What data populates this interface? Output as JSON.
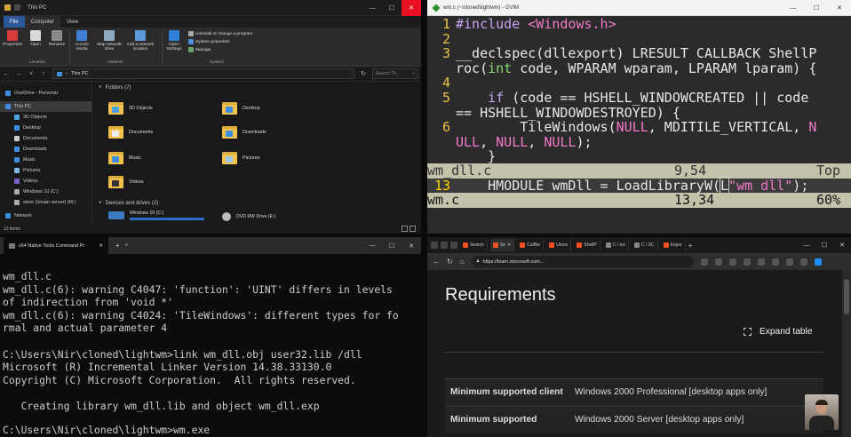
{
  "explorer": {
    "title": "This PC",
    "menu": [
      "File",
      "Computer",
      "View"
    ],
    "ribbon": {
      "buttons": [
        "Properties",
        "Open",
        "Rename",
        "Access media",
        "Map network drive",
        "Add a network location",
        "Open Settings"
      ],
      "system_items": [
        "Uninstall or change a program",
        "System properties",
        "Manage"
      ],
      "groups": [
        "Location",
        "Network",
        "System"
      ]
    },
    "address": "This PC",
    "search_placeholder": "Search Th...",
    "nav": [
      "OneDrive - Personal",
      "This PC",
      "3D Objects",
      "Desktop",
      "Documents",
      "Downloads",
      "Music",
      "Pictures",
      "Videos",
      "Windows 10 (C:)",
      "store (\\\\main server) (M:)",
      "Network"
    ],
    "folders_header": "Folders (7)",
    "folders": [
      "3D Objects",
      "Desktop",
      "Documents",
      "Downloads",
      "Music",
      "Pictures",
      "Videos"
    ],
    "devices_header": "Devices and drives (2)",
    "drives": [
      "Windows 10 (C:)",
      "DVD RW Drive (E:)"
    ],
    "status": "12 items"
  },
  "gvim": {
    "title": "wm.c (~\\cloned\\lightwm) - GVIM",
    "code": {
      "l1_num": "1",
      "l1_kw": "#include ",
      "l1_str": "<Windows.h>",
      "l2_num": "2",
      "l3_num": "3",
      "l3a": "__declspec(dllexport) LRESULT CALLBACK ShellP",
      "l3b_1": "roc(",
      "l3b_type1": "int",
      "l3b_2": " code, WPARAM wparam, LPARAM lparam) {",
      "l4_num": "4",
      "l5_num": "5",
      "l5a_1": "    ",
      "l5a_kw": "if",
      "l5a_2": " (code == HSHELL_WINDOWCREATED || code",
      "l5b": "== HSHELL_WINDOWDESTROYED) {",
      "l6_num": "6",
      "l6a_1": "        TileWindows(",
      "l6a_m1": "NULL",
      "l6a_2": ", MDITILE_VERTICAL, ",
      "l6a_m2": "N",
      "l6b_m": "ULL",
      "l6b_2": ", ",
      "l6b_m2": "NULL",
      "l6b_3": ", ",
      "l6b_m3": "NULL",
      "l6b_4": ");",
      "l7": "    }",
      "status1_name": "wm_dll.c",
      "status1_pos": "9,54",
      "status1_scroll": "Top",
      "l13_num": "13",
      "l13_1": "    HMODULE wmDll = LoadLibraryW(",
      "l13_L": "L",
      "l13_str": "\"wm_dll\"",
      "l13_2": ");",
      "status2_name": "wm.c",
      "status2_pos": "13,34",
      "status2_scroll": "60%"
    }
  },
  "terminal": {
    "tab_title": "x64 Native Tools Command Pr",
    "lines": [
      "wm_dll.c",
      "wm_dll.c(6): warning C4047: 'function': 'UINT' differs in levels",
      "of indirection from 'void *'",
      "wm_dll.c(6): warning C4024: 'TileWindows': different types for fo",
      "rmal and actual parameter 4",
      "",
      "C:\\Users\\Nir\\cloned\\lightwm>link wm_dll.obj user32.lib /dll",
      "Microsoft (R) Incremental Linker Version 14.38.33130.0",
      "Copyright (C) Microsoft Corporation.  All rights reserved.",
      "",
      "   Creating library wm_dll.lib and object wm_dll.exp",
      "",
      "C:\\Users\\Nir\\cloned\\lightwm>wm.exe"
    ]
  },
  "browser": {
    "tabs": [
      "Search",
      "Se",
      "CallNe",
      "Umoc",
      "ShellP",
      "C / exi",
      "C / SC",
      "Expor"
    ],
    "url": "https://learn.microsoft.com...",
    "heading": "Requirements",
    "expand_label": "Expand table",
    "rows": [
      {
        "key": "Minimum supported client",
        "value": "Windows 2000 Professional [desktop apps only]"
      },
      {
        "key": "Minimum supported",
        "value": "Windows 2000 Server [desktop apps only]"
      }
    ]
  }
}
